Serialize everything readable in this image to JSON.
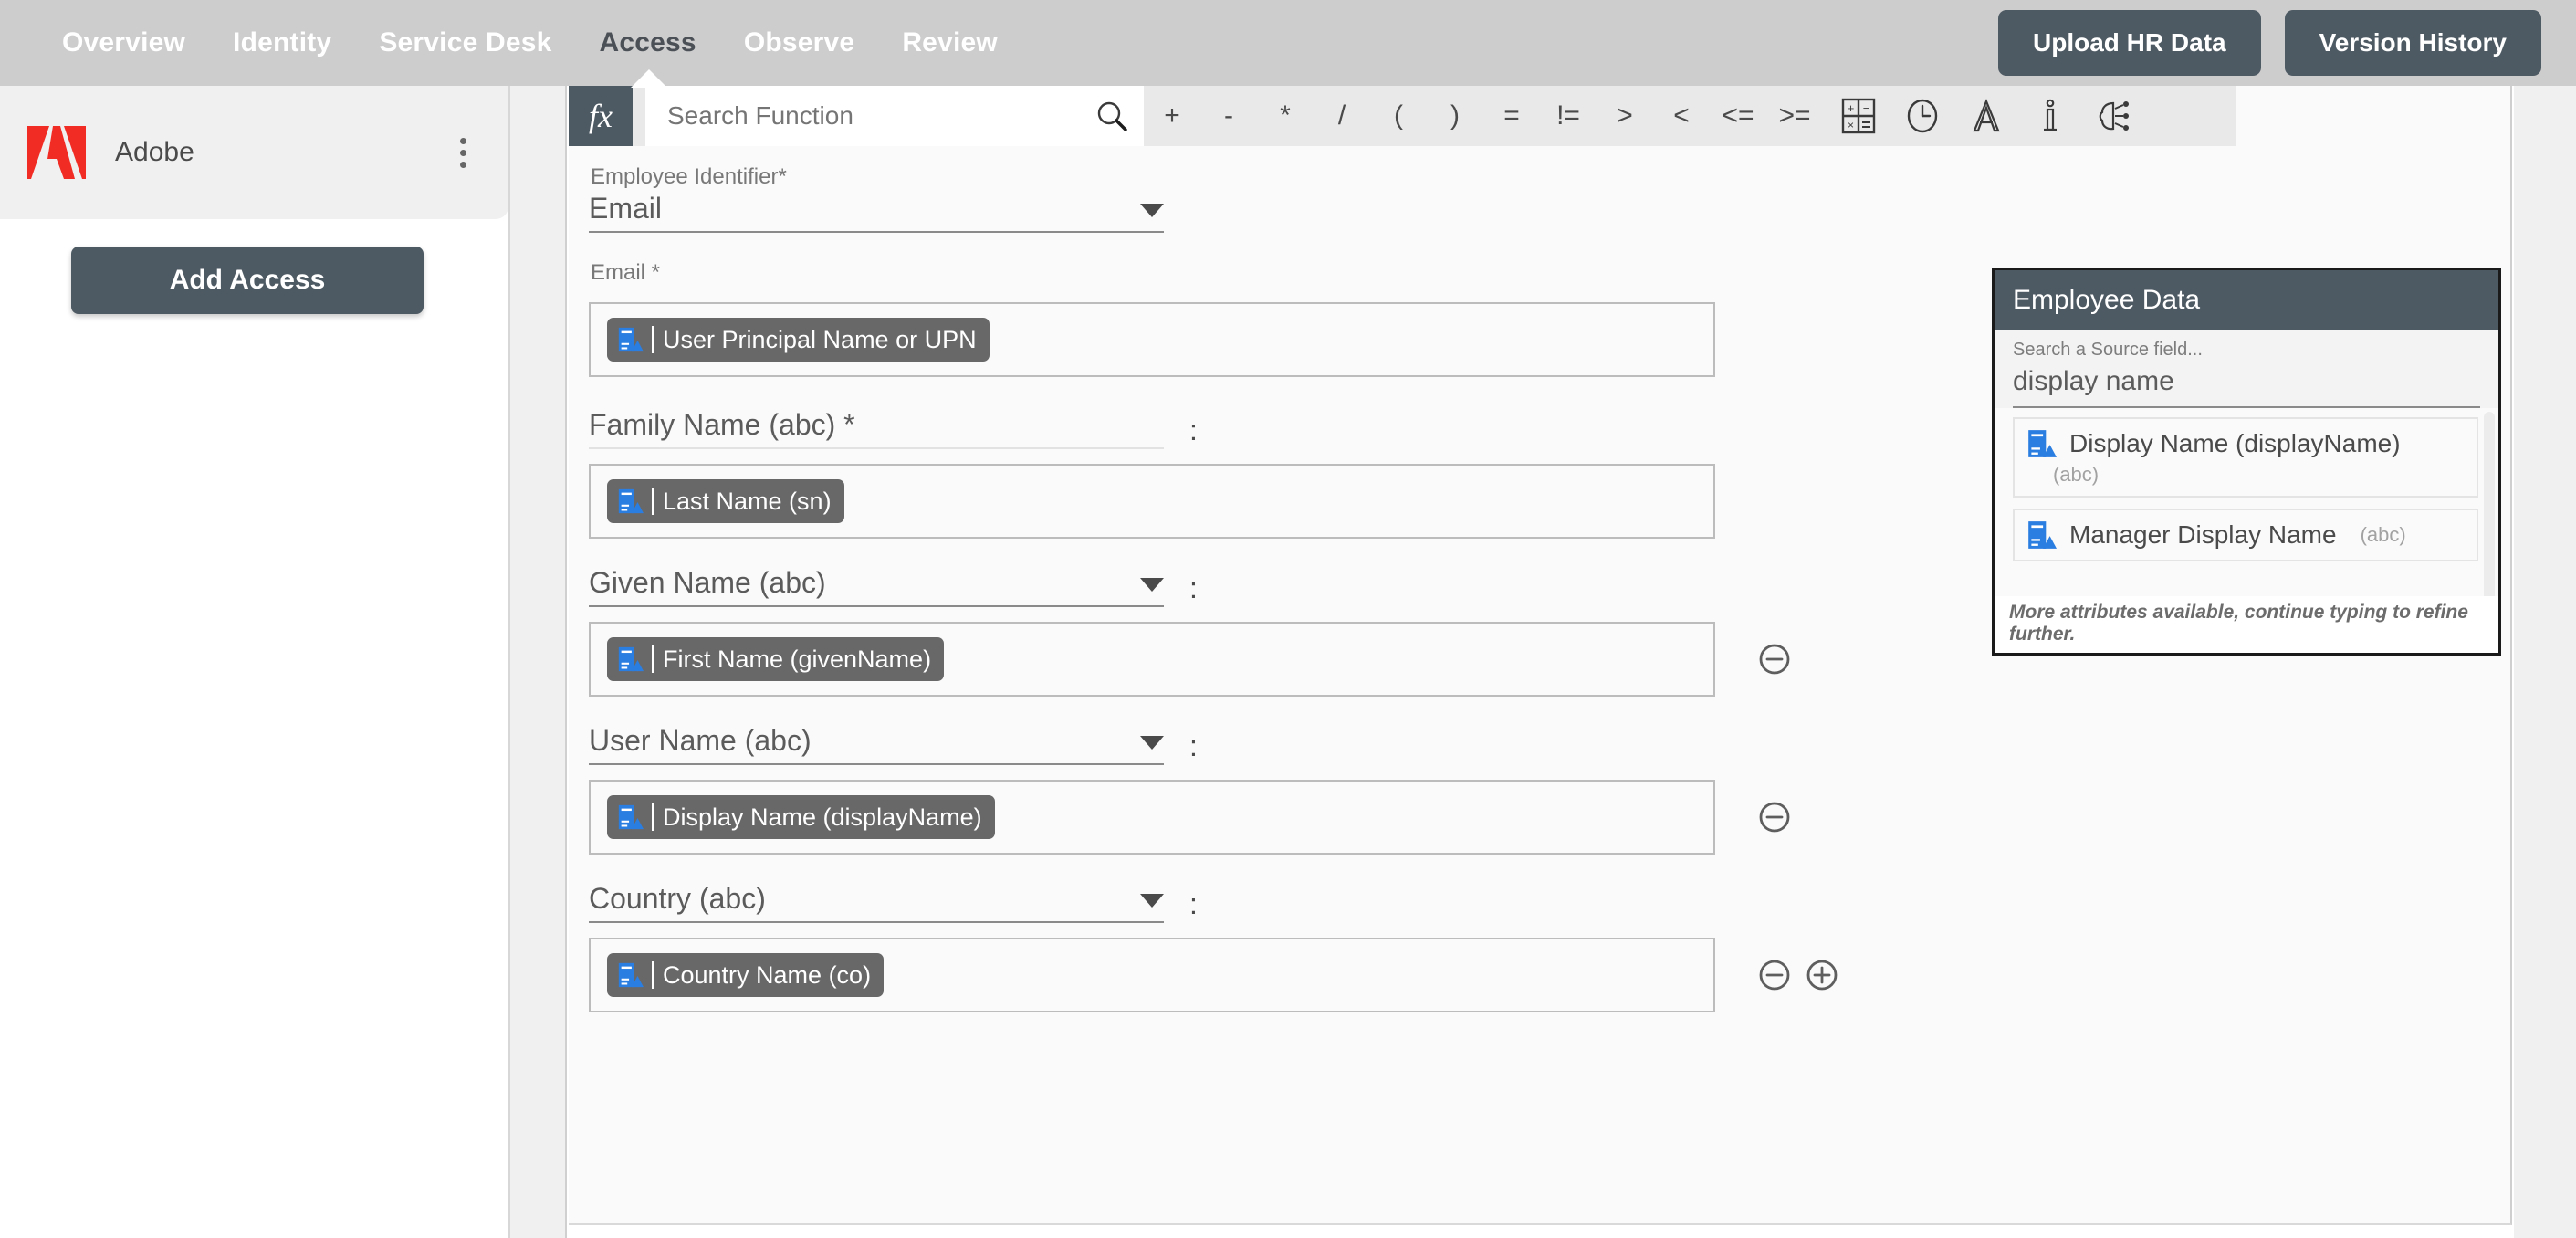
{
  "topnav": {
    "tabs": [
      {
        "label": "Overview",
        "active": false
      },
      {
        "label": "Identity",
        "active": false
      },
      {
        "label": "Service Desk",
        "active": false
      },
      {
        "label": "Access",
        "active": true
      },
      {
        "label": "Observe",
        "active": false
      },
      {
        "label": "Review",
        "active": false
      }
    ],
    "upload_button": "Upload HR Data",
    "version_button": "Version History",
    "bg_color": "#cdcdcd",
    "button_color": "#4e5a63"
  },
  "sidebar": {
    "org_name": "Adobe",
    "org_logo": "adobe-logo-icon",
    "menu_icon": "kebab-menu-icon",
    "add_access_button": "Add Access",
    "logo_color": "#f02c24"
  },
  "toolbar": {
    "fx_label": "fx",
    "search_placeholder": "Search Function",
    "search_value": "",
    "search_icon": "search-icon",
    "operators": [
      "+",
      "-",
      "*",
      "/",
      "(",
      ")",
      "=",
      "!=",
      ">",
      "<",
      "<=",
      ">="
    ],
    "icons": [
      {
        "name": "calculator-icon",
        "title": "Math functions"
      },
      {
        "name": "clock-icon",
        "title": "Date functions"
      },
      {
        "name": "text-format-icon",
        "title": "Text functions"
      },
      {
        "name": "info-icon",
        "title": "Info functions"
      },
      {
        "name": "ai-brain-icon",
        "title": "AI assist"
      }
    ]
  },
  "form": {
    "fields": [
      {
        "label": "Employee Identifier*",
        "select_value": "Email",
        "has_caret": true,
        "faint_underline": false,
        "has_colon": false,
        "simple_label": false,
        "chip": null,
        "controls": []
      },
      {
        "label": "Email *",
        "select_value": null,
        "has_caret": false,
        "faint_underline": false,
        "has_colon": false,
        "simple_label": true,
        "chip": {
          "text": "User Principal Name or UPN",
          "icon": "source-field-icon"
        },
        "controls": []
      },
      {
        "label": "Family Name (abc) *",
        "select_value": null,
        "has_caret": false,
        "faint_underline": true,
        "has_colon": true,
        "simple_label": false,
        "chip": {
          "text": "Last Name (sn)",
          "icon": "source-field-icon"
        },
        "controls": []
      },
      {
        "label": "Given Name (abc)",
        "select_value": null,
        "has_caret": true,
        "faint_underline": false,
        "has_colon": true,
        "simple_label": false,
        "chip": {
          "text": "First Name (givenName)",
          "icon": "source-field-icon"
        },
        "controls": [
          "minus-circle-button"
        ]
      },
      {
        "label": "User Name (abc)",
        "select_value": null,
        "has_caret": true,
        "faint_underline": false,
        "has_colon": true,
        "simple_label": false,
        "chip": {
          "text": "Display Name (displayName)",
          "icon": "source-field-icon"
        },
        "controls": [
          "minus-circle-button"
        ]
      },
      {
        "label": "Country (abc)",
        "select_value": null,
        "has_caret": true,
        "faint_underline": false,
        "has_colon": true,
        "simple_label": false,
        "chip": {
          "text": "Country Name (co)",
          "icon": "source-field-icon"
        },
        "controls": [
          "minus-circle-button",
          "plus-circle-button"
        ]
      }
    ]
  },
  "employee_data_panel": {
    "title": "Employee Data",
    "search_label": "Search a Source field...",
    "search_value": "display name",
    "results": [
      {
        "name": "Display Name (displayName)",
        "type": "(abc)",
        "type_below": true,
        "icon": "source-field-icon"
      },
      {
        "name": "Manager Display Name",
        "type": "(abc)",
        "type_below": false,
        "icon": "source-field-icon"
      }
    ],
    "footer_note": "More attributes available, continue typing to refine further.",
    "header_color": "#4e5a63",
    "icon_color": "#2a7de1"
  }
}
